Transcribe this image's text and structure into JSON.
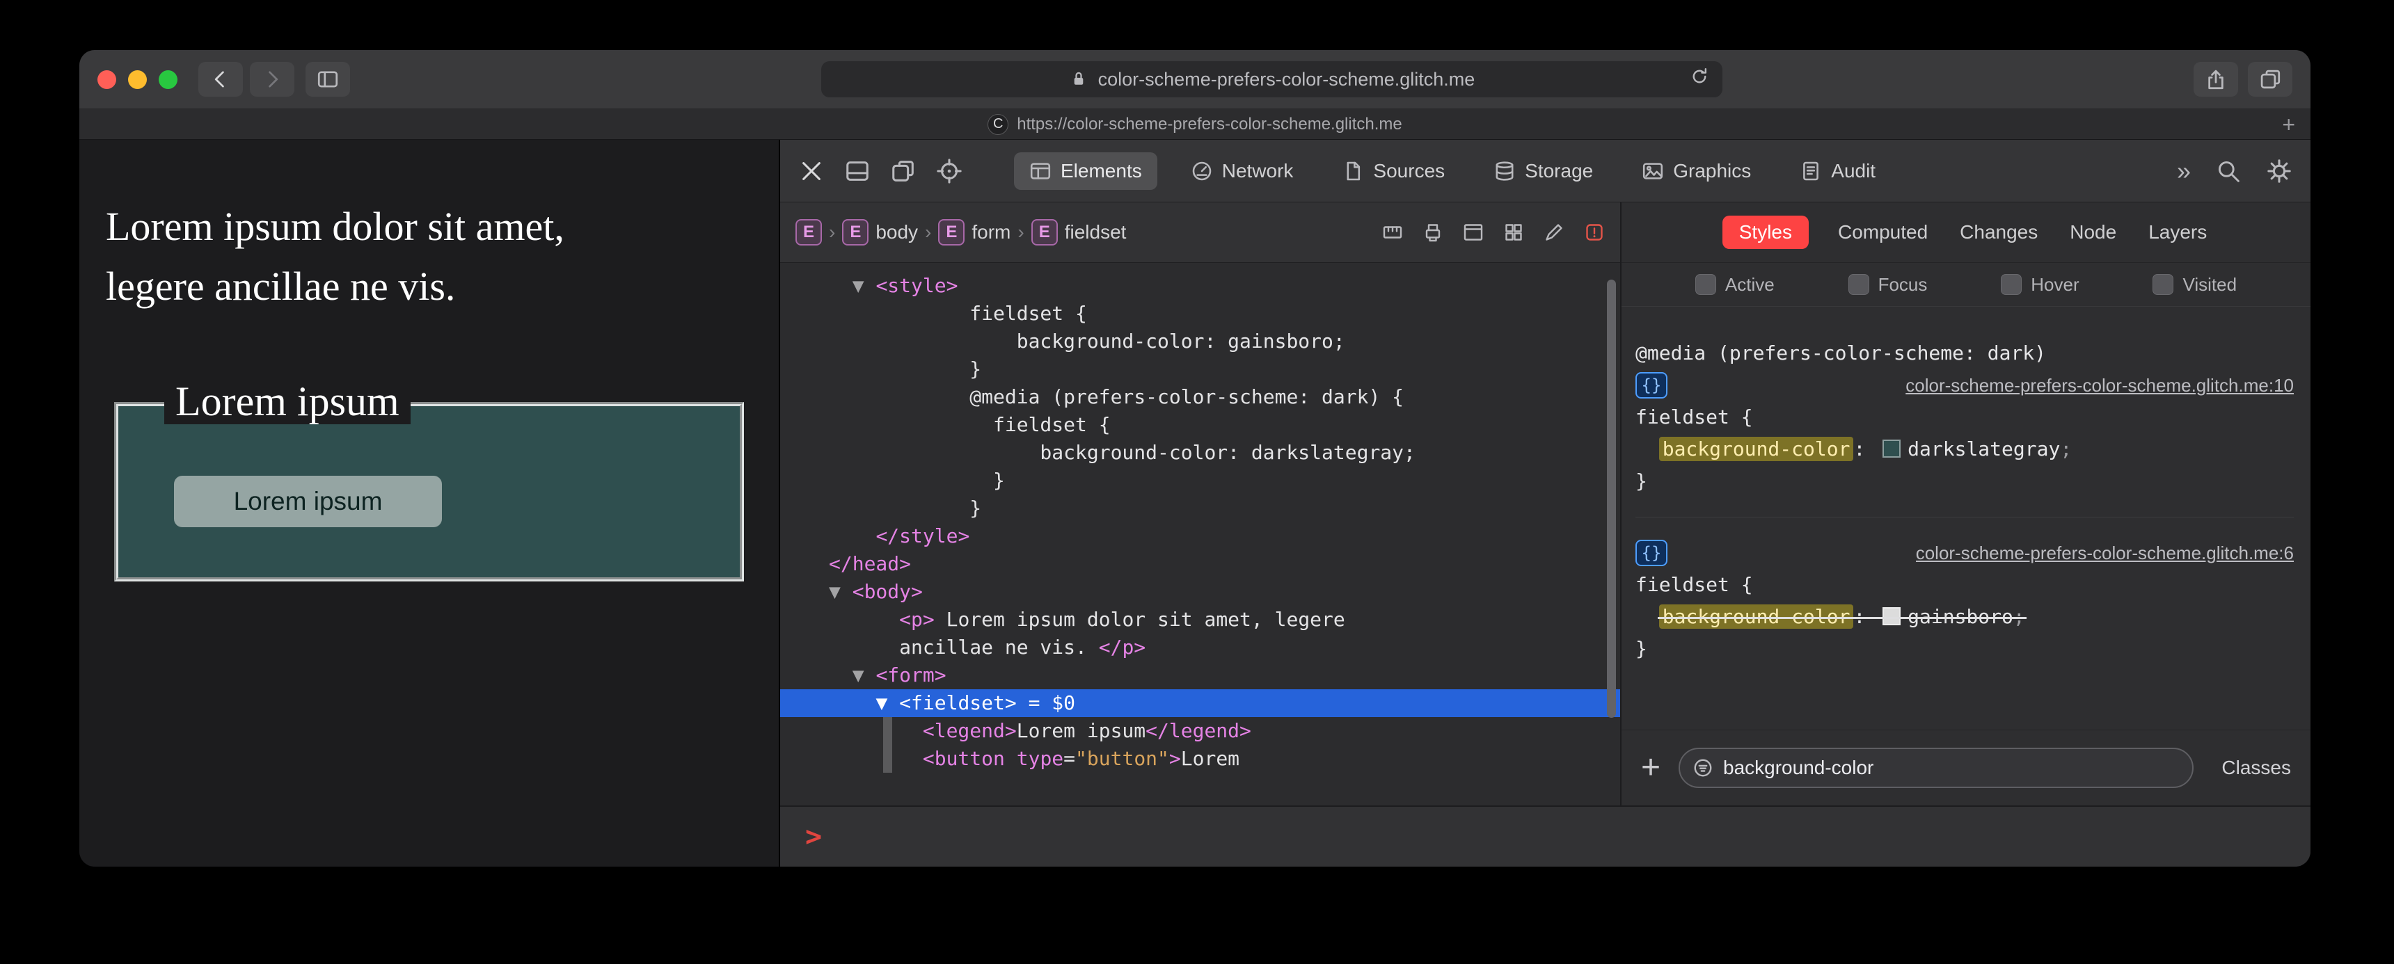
{
  "titlebar": {
    "url": "color-scheme-prefers-color-scheme.glitch.me"
  },
  "tabbar": {
    "favicon_letter": "C",
    "tab_url": "https://color-scheme-prefers-color-scheme.glitch.me",
    "new_tab": "+"
  },
  "page": {
    "paragraph": "Lorem ipsum dolor sit amet, legere ancillae ne vis.",
    "fieldset_legend": "Lorem ipsum",
    "button_label": "Lorem ipsum",
    "colors": {
      "page_bg": "#1c1c1e",
      "fieldset_bg": "#2f4f4f"
    }
  },
  "devtools": {
    "tabs": [
      {
        "label": "Elements",
        "active": true
      },
      {
        "label": "Network",
        "active": false
      },
      {
        "label": "Sources",
        "active": false
      },
      {
        "label": "Storage",
        "active": false
      },
      {
        "label": "Graphics",
        "active": false
      },
      {
        "label": "Audit",
        "active": false
      }
    ],
    "overflow_chevron": "»",
    "breadcrumbs": [
      {
        "badge": "E",
        "label": ""
      },
      {
        "badge": "E",
        "label": "body"
      },
      {
        "badge": "E",
        "label": "form"
      },
      {
        "badge": "E",
        "label": "fieldset"
      }
    ],
    "dom_tree": {
      "lines": [
        {
          "seg": [
            [
              "code",
              "  "
            ],
            [
              "tri",
              "▼ "
            ],
            [
              "tag",
              "<style>"
            ]
          ]
        },
        {
          "seg": [
            [
              "code",
              "            fieldset {"
            ]
          ]
        },
        {
          "seg": [
            [
              "code",
              "                background-color: gainsboro;"
            ]
          ]
        },
        {
          "seg": [
            [
              "code",
              "            }"
            ]
          ]
        },
        {
          "seg": [
            [
              "code",
              "            @media (prefers-color-scheme: dark) {"
            ]
          ]
        },
        {
          "seg": [
            [
              "code",
              "              fieldset {"
            ]
          ]
        },
        {
          "seg": [
            [
              "code",
              "                  background-color: darkslategray;"
            ]
          ]
        },
        {
          "seg": [
            [
              "code",
              "              }"
            ]
          ]
        },
        {
          "seg": [
            [
              "code",
              "            }"
            ]
          ]
        },
        {
          "seg": [
            [
              "code",
              "    "
            ],
            [
              "tag",
              "</style>"
            ]
          ]
        },
        {
          "seg": [
            [
              "tag",
              "</head>"
            ]
          ]
        },
        {
          "seg": [
            [
              "tri",
              "▼ "
            ],
            [
              "tag",
              "<body>"
            ]
          ]
        },
        {
          "seg": [
            [
              "code",
              "      "
            ],
            [
              "tag",
              "<p>"
            ],
            [
              "code",
              " Lorem ipsum dolor sit amet, legere"
            ]
          ]
        },
        {
          "seg": [
            [
              "code",
              "      ancillae ne vis. "
            ],
            [
              "tag",
              "</p>"
            ]
          ]
        },
        {
          "seg": [
            [
              "code",
              "  "
            ],
            [
              "tri",
              "▼ "
            ],
            [
              "tag",
              "<form>"
            ]
          ]
        },
        {
          "selected": true,
          "seg": [
            [
              "code",
              "    "
            ],
            [
              "tri",
              "▼ "
            ],
            [
              "tag",
              "<fieldset>"
            ],
            [
              "code",
              " = $0"
            ]
          ]
        },
        {
          "seg": [
            [
              "code",
              "        "
            ],
            [
              "tag",
              "<legend>"
            ],
            [
              "code",
              "Lorem ipsum"
            ],
            [
              "tag",
              "</legend>"
            ]
          ]
        },
        {
          "seg": [
            [
              "code",
              "        "
            ],
            [
              "tag",
              "<button"
            ],
            [
              "code",
              " "
            ],
            [
              "attr",
              "type"
            ],
            [
              "code",
              "="
            ],
            [
              "val",
              "\"button\""
            ],
            [
              "tag",
              ">"
            ],
            [
              "code",
              "Lorem"
            ]
          ]
        }
      ]
    },
    "sidebar": {
      "tabs": [
        {
          "label": "Styles",
          "active": true
        },
        {
          "label": "Computed",
          "active": false
        },
        {
          "label": "Changes",
          "active": false
        },
        {
          "label": "Node",
          "active": false
        },
        {
          "label": "Layers",
          "active": false
        }
      ],
      "pseudo_toggles": [
        "Active",
        "Focus",
        "Hover",
        "Visited"
      ],
      "brace_badge": "{}",
      "rules": [
        {
          "media": "@media (prefers-color-scheme: dark)",
          "source_link": "color-scheme-prefers-color-scheme.glitch.me:10",
          "selector": "fieldset {",
          "declarations": [
            {
              "property": "background-color",
              "value": "darkslategray",
              "swatch": "#2f4f4f",
              "overridden": false,
              "highlighted": true
            }
          ],
          "close": "}"
        },
        {
          "media": null,
          "source_link": "color-scheme-prefers-color-scheme.glitch.me:6",
          "selector": "fieldset {",
          "declarations": [
            {
              "property": "background-color",
              "value": "gainsboro",
              "swatch": "#dcdcdc",
              "overridden": true,
              "highlighted": true
            }
          ],
          "close": "}"
        }
      ],
      "footer": {
        "new_rule_glyph": "+",
        "filter_value": "background-color",
        "classes_label": "Classes"
      }
    },
    "console_prompt": ">",
    "colors": {
      "accent_red": "#fd4343",
      "selection_blue": "#2663da",
      "tag_pink": "#e583e5",
      "attr_value_orange": "#d9a45c",
      "match_highlight_bg": "#7d7226"
    }
  }
}
